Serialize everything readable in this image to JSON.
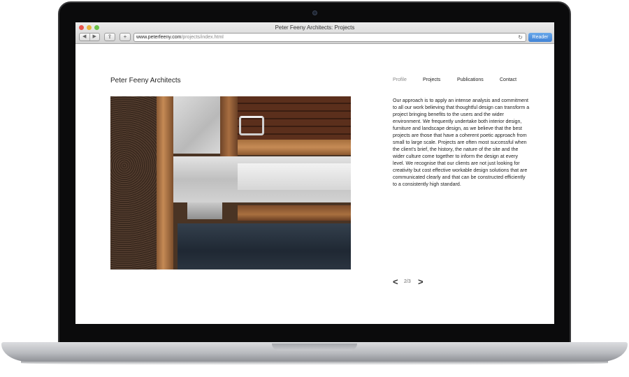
{
  "window": {
    "title": "Peter Feeny Architects: Projects"
  },
  "toolbar": {
    "url_host": "www.peterfeeny.com",
    "url_path": "/projects/index.html",
    "reader_label": "Reader",
    "back_glyph": "◀",
    "forward_glyph": "▶",
    "share_glyph": "⇪",
    "add_glyph": "+",
    "reload_glyph": "↻"
  },
  "site": {
    "name": "Peter Feeny Architects",
    "nav": [
      "Profile",
      "Projects",
      "Publications",
      "Contact"
    ],
    "description": "Our approach is to apply an intense analysis and commitment to all our work believing that thoughtful design can transform a project bringing benefits to the users and the wider environment. We frequently undertake both interior design, furniture and landscape design, as we believe that the best projects are those that have a coherent poetic approach from small to large scale. Projects are often most successful when the client's brief, the history, the nature of the site and the wider culture come together to inform the design at every level. We recognise that our clients are not just looking for creativity but cost effective workable design solutions that are communicated clearly and that can be constructed efficiently to a consistently high standard.",
    "pager": {
      "prev": "<",
      "count": "2/3",
      "next": ">"
    }
  },
  "colors": {
    "reader_button": "#3f82d6",
    "active_nav": "#8a8a8a",
    "bezel": "#0b0b0c"
  }
}
